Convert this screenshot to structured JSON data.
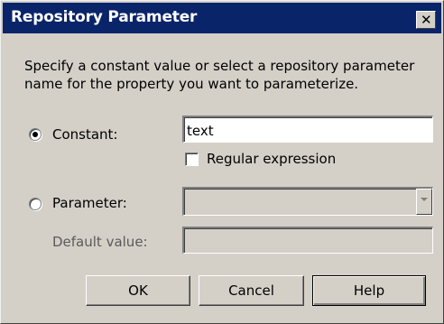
{
  "dialog": {
    "title": "Repository Parameter",
    "close_glyph": "✕",
    "description": "Specify a constant value or select a repository parameter name for the property you want to parameterize."
  },
  "constant": {
    "label": "Constant:",
    "selected": true,
    "value": "text"
  },
  "regex": {
    "label": "Regular expression",
    "checked": false
  },
  "parameter": {
    "label": "Parameter:",
    "selected": false,
    "value": ""
  },
  "default_value": {
    "label": "Default value:",
    "value": ""
  },
  "buttons": {
    "ok": "OK",
    "cancel": "Cancel",
    "help": "Help"
  },
  "colors": {
    "titlebar": "#0a246a",
    "dialog_bg": "#d4d0c8"
  }
}
